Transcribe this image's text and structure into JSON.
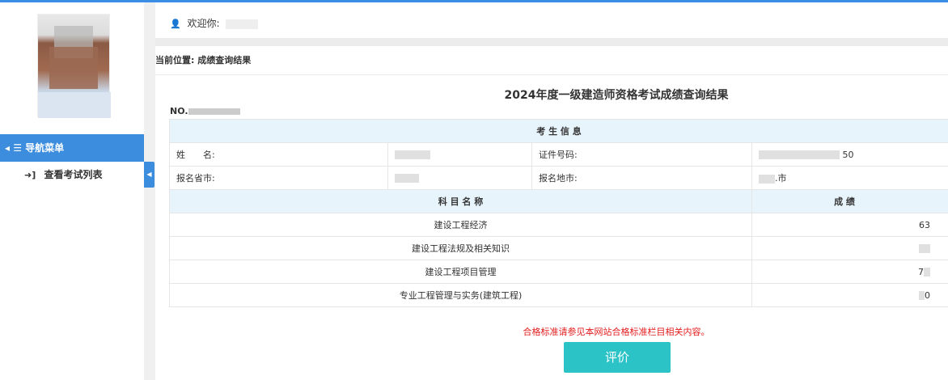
{
  "sidebar": {
    "nav_header": "◂ ☰ 导航菜单",
    "items": [
      {
        "label": "查看考试列表"
      }
    ]
  },
  "topbar": {
    "welcome": "欢迎你:"
  },
  "breadcrumb": "当前位置: 成绩查询结果",
  "result": {
    "title": "2024年度一级建造师资格考试成绩查询结果",
    "no_label": "NO.",
    "section_header": "考 生 信 息",
    "info": {
      "name_label": "姓　　名:",
      "id_label": "证件号码:",
      "id_value_suffix": "50",
      "province_label": "报名省市:",
      "city_label": "报名地市:",
      "city_value_suffix": ".市"
    },
    "score_header": {
      "subject": "科 目 名 称",
      "score": "成 绩"
    },
    "subjects": [
      {
        "name": "建设工程经济",
        "score": "63"
      },
      {
        "name": "建设工程法规及相关知识",
        "score": ""
      },
      {
        "name": "建设工程项目管理",
        "score": "7"
      },
      {
        "name": "专业工程管理与实务(建筑工程)",
        "score": "0"
      }
    ],
    "notice": "合格标准请参见本网站合格标准栏目相关内容。",
    "evaluate_button": "评价"
  },
  "colors": {
    "accent": "#3c8dde",
    "button": "#2cc3c7",
    "notice": "#e21c1c",
    "band": "#e8f4fc"
  },
  "icons": [
    "user-icon",
    "sign-in-icon",
    "menu-icon",
    "collapse-arrow-icon"
  ]
}
